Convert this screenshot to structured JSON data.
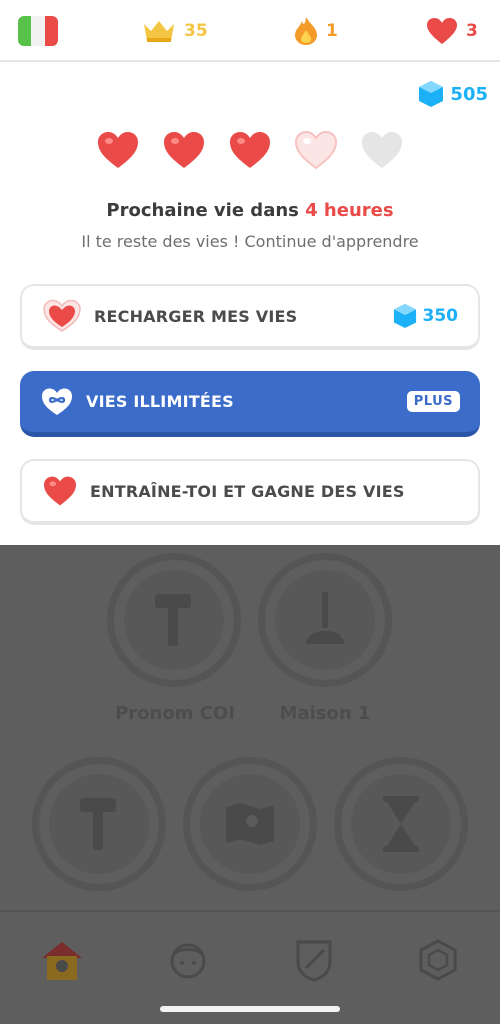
{
  "topbar": {
    "flag_icon": "italy-flag-icon",
    "flag_colors": [
      "#58c14a",
      "#ffffff",
      "#ea4b48"
    ],
    "crowns": "35",
    "streak": "1",
    "hearts": "3",
    "colors": {
      "crown": "#f4c542",
      "streak": "#f49c2a",
      "heart": "#ea4b48"
    }
  },
  "panel": {
    "gems": "505",
    "hearts_row": [
      "full",
      "full",
      "full",
      "refilling",
      "empty"
    ],
    "next_life_prefix": "Prochaine vie dans ",
    "next_life_time": "4 heures",
    "subtext": "Il te reste des vies ! Continue d'apprendre",
    "buttons": {
      "refill": {
        "label": "RECHARGER MES VIES",
        "cost": "350"
      },
      "unlimited": {
        "label": "VIES ILLIMITÉES",
        "badge": "PLUS"
      },
      "practice": {
        "label": "ENTRAÎNE-TOI ET GAGNE DES VIES"
      }
    },
    "colors": {
      "gem": "#1cb0f6",
      "accent_red": "#ea4b48",
      "plus_blue": "#3b6cc9"
    }
  },
  "background": {
    "skills": [
      {
        "label": "Pronom COI",
        "icon": "hammer-icon"
      },
      {
        "label": "Maison 1",
        "icon": "plunger-icon"
      },
      {
        "label": "",
        "icon": "hammer-icon"
      },
      {
        "label": "",
        "icon": "map-icon"
      },
      {
        "label": "",
        "icon": "hourglass-icon"
      }
    ]
  },
  "bottom_nav": [
    "home-icon",
    "profile-icon",
    "leagues-shield-icon",
    "shop-gem-icon"
  ]
}
